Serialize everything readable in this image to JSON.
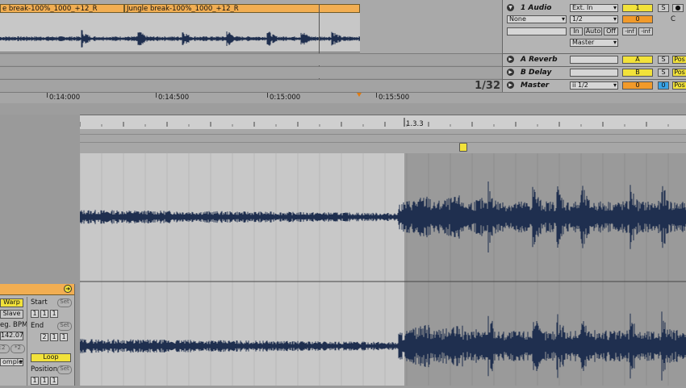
{
  "arrangement": {
    "clips": [
      {
        "name": "e break-100%_1000_+12_R"
      },
      {
        "name": "Jungle break-100%_1000_+12_R"
      }
    ],
    "loop_display": "1/32",
    "time_ticks": [
      "0:14:000",
      "0:14:500",
      "0:15:000",
      "0:15:500"
    ]
  },
  "mixer": {
    "audio_track": {
      "name": "1 Audio",
      "input_type": "Ext. In",
      "input_channel": "None",
      "channel": "1/2",
      "monitor": [
        "In",
        "Auto",
        "Off"
      ],
      "output": "Master",
      "number": "1",
      "solo": "S",
      "volume": "0",
      "pan": "C",
      "peak_left": "-inf",
      "peak_right": "-inf"
    },
    "returns": [
      {
        "name": "A Reverb",
        "letter": "A",
        "solo": "S",
        "post": "Pos"
      },
      {
        "name": "B Delay",
        "letter": "B",
        "solo": "S",
        "post": "Pos"
      }
    ],
    "master": {
      "name": "Master",
      "output": "ii 1/2",
      "volume": "0",
      "cue": "0",
      "post": "Pos"
    }
  },
  "clip_view": {
    "beat_marker": "1.3.3",
    "warp": "Warp",
    "mode": "Slave",
    "seg_bpm_label": "eg. BPM",
    "bpm": "142.07",
    "half": ":2",
    "double": "*2",
    "warp_mode": "omple",
    "start_label": "Start",
    "end_label": "End",
    "set": "Set",
    "start_values": [
      "1",
      "1",
      "1"
    ],
    "end_values": [
      "2",
      "1",
      "1"
    ],
    "loop": "Loop",
    "position_label": "Position",
    "position_values": [
      "1",
      "1",
      "1"
    ]
  },
  "colors": {
    "clip": "#f2ae52",
    "highlight": "#f2e23a",
    "orange": "#f19a2a",
    "cue": "#3aa3e6",
    "waveform": "#1f2f4f"
  }
}
